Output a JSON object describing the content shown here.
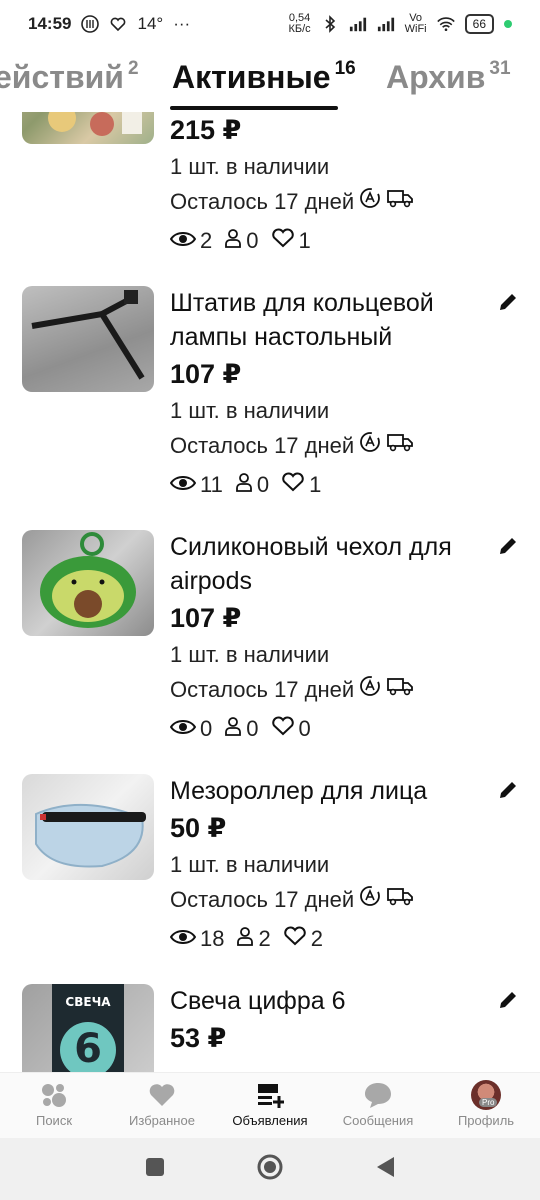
{
  "status_bar": {
    "time": "14:59",
    "temperature": "14°",
    "more": "···",
    "net_speed_value": "0,54",
    "net_speed_unit": "КБ/с",
    "vowifi_top": "Vo",
    "vowifi_bottom": "WiFi",
    "battery": "66"
  },
  "tabs": [
    {
      "label": "ействий",
      "count": "2"
    },
    {
      "label": "Активные",
      "count": "16"
    },
    {
      "label": "Архив",
      "count": "31"
    }
  ],
  "items": [
    {
      "title": "",
      "price": "215 ₽",
      "stock": "1 шт. в наличии",
      "days_left": "Осталось 17 дней",
      "views": "2",
      "contacts": "0",
      "favorites": "1"
    },
    {
      "title": "Штатив для кольцевой лампы настольный",
      "price": "107 ₽",
      "stock": "1 шт. в наличии",
      "days_left": "Осталось 17 дней",
      "views": "11",
      "contacts": "0",
      "favorites": "1"
    },
    {
      "title": "Силиконовый чехол для airpods",
      "price": "107 ₽",
      "stock": "1 шт. в наличии",
      "days_left": "Осталось 17 дней",
      "views": "0",
      "contacts": "0",
      "favorites": "0"
    },
    {
      "title": "Мезороллер для лица",
      "price": "50 ₽",
      "stock": "1 шт. в наличии",
      "days_left": "Осталось 17 дней",
      "views": "18",
      "contacts": "2",
      "favorites": "2"
    },
    {
      "title": "Свеча цифра 6",
      "price": "53 ₽",
      "thumb_text": "СВЕЧА",
      "thumb_digit": "6"
    }
  ],
  "bottom_nav": [
    {
      "label": "Поиск",
      "icon": "search-dots-icon"
    },
    {
      "label": "Избранное",
      "icon": "heart-icon"
    },
    {
      "label": "Объявления",
      "icon": "listings-add-icon",
      "active": true
    },
    {
      "label": "Сообщения",
      "icon": "chat-bubble-icon"
    },
    {
      "label": "Профиль",
      "icon": "avatar",
      "badge": "Pro"
    }
  ],
  "colors": {
    "text": "#111111",
    "muted": "#8a8a8a",
    "status_dot": "#2ecc71"
  }
}
